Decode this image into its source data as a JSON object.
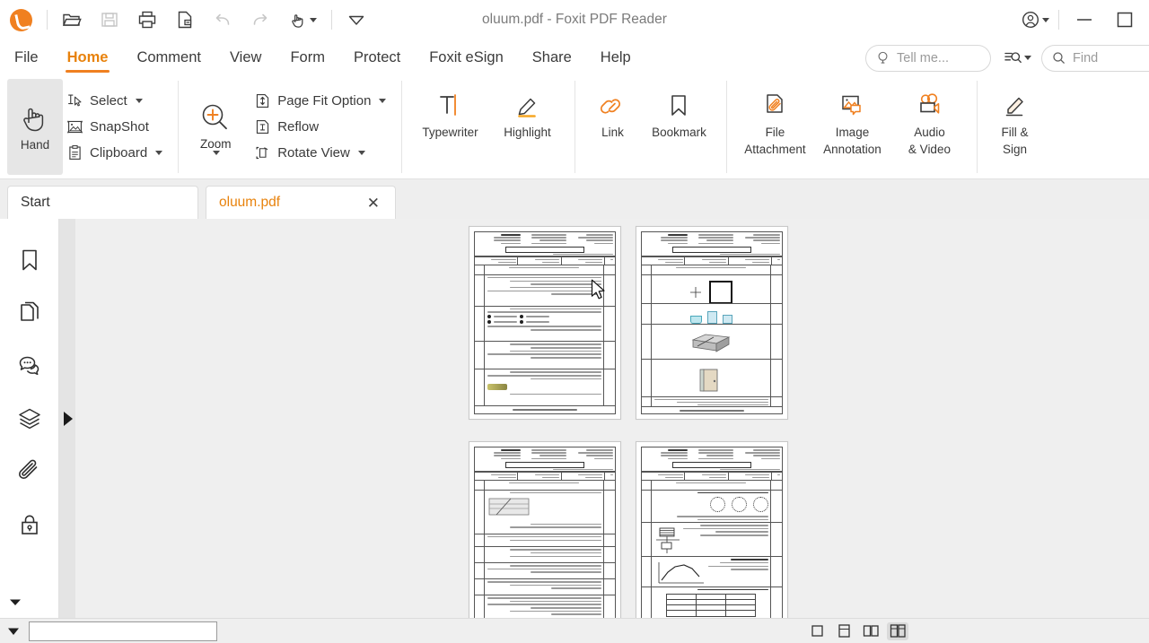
{
  "window": {
    "title": "oluum.pdf - Foxit PDF Reader",
    "accent_color": "#f08020",
    "quick_access": [
      {
        "name": "open-file",
        "label": "Open",
        "enabled": true
      },
      {
        "name": "save-file",
        "label": "Save",
        "enabled": false
      },
      {
        "name": "print",
        "label": "Print",
        "enabled": true
      },
      {
        "name": "export",
        "label": "Export PDF",
        "enabled": true
      },
      {
        "name": "undo",
        "label": "Undo",
        "enabled": false
      },
      {
        "name": "redo",
        "label": "Redo",
        "enabled": false
      },
      {
        "name": "hand-tool",
        "label": "Hand Tool",
        "enabled": true
      },
      {
        "name": "customize-toolbar",
        "label": "Customize",
        "enabled": true
      }
    ],
    "controls": {
      "account": "Account",
      "minimize": "Minimize",
      "maximize": "Maximize"
    }
  },
  "menu": {
    "items": [
      {
        "label": "File",
        "active": false
      },
      {
        "label": "Home",
        "active": true
      },
      {
        "label": "Comment",
        "active": false
      },
      {
        "label": "View",
        "active": false
      },
      {
        "label": "Form",
        "active": false
      },
      {
        "label": "Protect",
        "active": false
      },
      {
        "label": "Foxit eSign",
        "active": false
      },
      {
        "label": "Share",
        "active": false
      },
      {
        "label": "Help",
        "active": false
      }
    ],
    "tell_me_placeholder": "Tell me...",
    "find_placeholder": "Find",
    "search_options_label": "Search Options"
  },
  "ribbon": {
    "tools": {
      "hand": "Hand",
      "select": "Select",
      "snapshot": "SnapShot",
      "clipboard": "Clipboard"
    },
    "view": {
      "zoom": "Zoom",
      "page_fit_option": "Page Fit Option",
      "reflow": "Reflow",
      "rotate_view": "Rotate View"
    },
    "comment": {
      "typewriter": "Typewriter",
      "highlight": "Highlight"
    },
    "links": {
      "link": "Link",
      "bookmark": "Bookmark"
    },
    "insert": {
      "file_attachment_line1": "File",
      "file_attachment_line2": "Attachment",
      "image_annotation_line1": "Image",
      "image_annotation_line2": "Annotation",
      "audio_video_line1": "Audio",
      "audio_video_line2": "& Video"
    },
    "sign": {
      "fill_sign_line1": "Fill &",
      "fill_sign_line2": "Sign"
    }
  },
  "doc_tabs": [
    {
      "label": "Start",
      "active": false,
      "closable": false
    },
    {
      "label": "oluum.pdf",
      "active": true,
      "closable": true,
      "close_glyph": "✕"
    }
  ],
  "nav_pane": {
    "items": [
      {
        "name": "bookmarks-panel",
        "label": "Bookmarks"
      },
      {
        "name": "pages-panel",
        "label": "Page Thumbnails"
      },
      {
        "name": "comments-panel",
        "label": "Comments"
      },
      {
        "name": "layers-panel",
        "label": "Layers"
      },
      {
        "name": "attachments-panel",
        "label": "Attachments"
      },
      {
        "name": "security-panel",
        "label": "Security"
      }
    ],
    "collapse_label": "More Panels",
    "expand_label": "Expand Navigation Pane"
  },
  "viewer": {
    "layout": "two-page-continuous",
    "background_color": "#efefef",
    "pages": [
      {
        "index": 1,
        "questions": 5,
        "has_figures": false
      },
      {
        "index": 2,
        "questions": 5,
        "has_figures": true
      },
      {
        "index": 3,
        "questions": 6,
        "has_figures": true
      },
      {
        "index": 4,
        "questions": 4,
        "has_figures": true
      }
    ],
    "footer_note": "Document page footer"
  },
  "status_bar": {
    "layout_buttons": [
      {
        "name": "single-page-layout",
        "label": "Single Page",
        "active": false
      },
      {
        "name": "continuous-layout",
        "label": "Continuous",
        "active": false
      },
      {
        "name": "two-page-layout",
        "label": "Facing",
        "active": false
      },
      {
        "name": "two-page-continuous-layout",
        "label": "Continuous Facing",
        "active": true
      }
    ],
    "page_field_value": ""
  }
}
